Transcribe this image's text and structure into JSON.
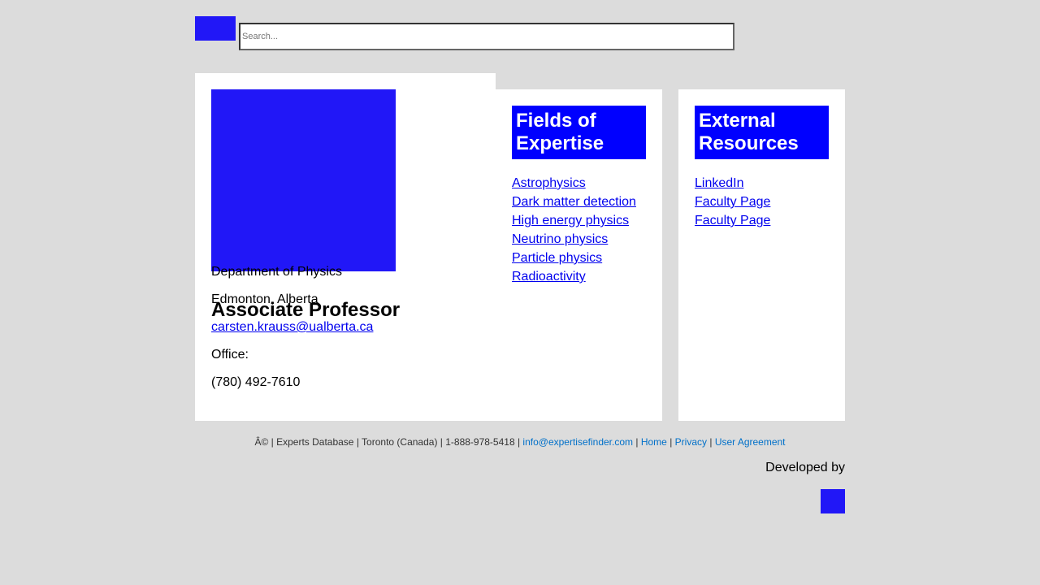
{
  "header": {
    "logo_icon": "site-logo",
    "search_placeholder": "Search..."
  },
  "profile": {
    "photo_icon": "profile-photo",
    "title": "Associate Professor",
    "department": "Department of Physics",
    "location": "Edmonton, Alberta",
    "email": "carsten.krauss@ualberta.ca",
    "office_label": "Office:",
    "phone": "(780) 492-7610"
  },
  "fields": {
    "heading": "Fields of Expertise",
    "items": [
      "Astrophysics",
      "Dark matter detection",
      "High energy physics",
      "Neutrino physics",
      "Particle physics",
      "Radioactivity"
    ]
  },
  "resources": {
    "heading": "External Resources",
    "items": [
      "LinkedIn",
      "Faculty Page",
      "Faculty Page"
    ]
  },
  "footer": {
    "text": "Â© | Experts Database | Toronto (Canada) | 1-888-978-5418 |",
    "email": "info@expertisefinder.com",
    "home": "Home",
    "privacy": "Privacy",
    "agreement": "User Agreement",
    "separator": "|",
    "developed_by": "Developed by",
    "developer_logo_icon": "developer-logo"
  },
  "colors": {
    "background": "#dcdcdc",
    "accent": "#2117f7",
    "heading_bg": "#0000ff",
    "link": "#0000ee",
    "footer_link": "#0070c9"
  }
}
